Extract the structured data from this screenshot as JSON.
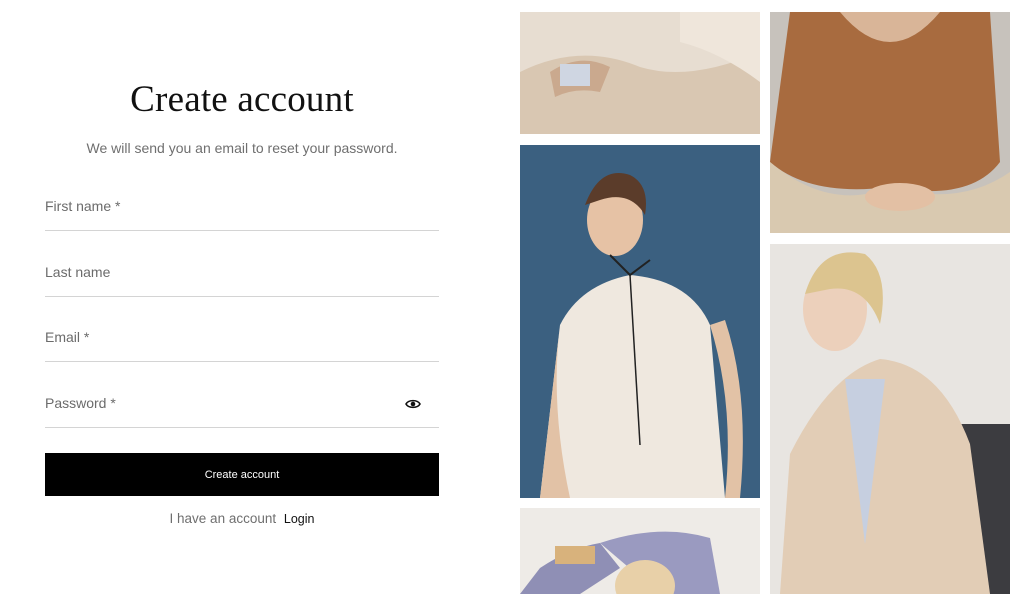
{
  "form": {
    "title": "Create account",
    "subtitle": "We will send you an email to reset your password.",
    "fields": [
      {
        "label": "First name *"
      },
      {
        "label": "Last name"
      },
      {
        "label": "Email *"
      },
      {
        "label": "Password *"
      }
    ],
    "submit_label": "Create account",
    "login_prompt": "I have an account",
    "login_link": "Login"
  },
  "icons": {
    "password_toggle": "eye-icon"
  },
  "colors": {
    "button_bg": "#000000",
    "divider": "#d4d4d4"
  }
}
